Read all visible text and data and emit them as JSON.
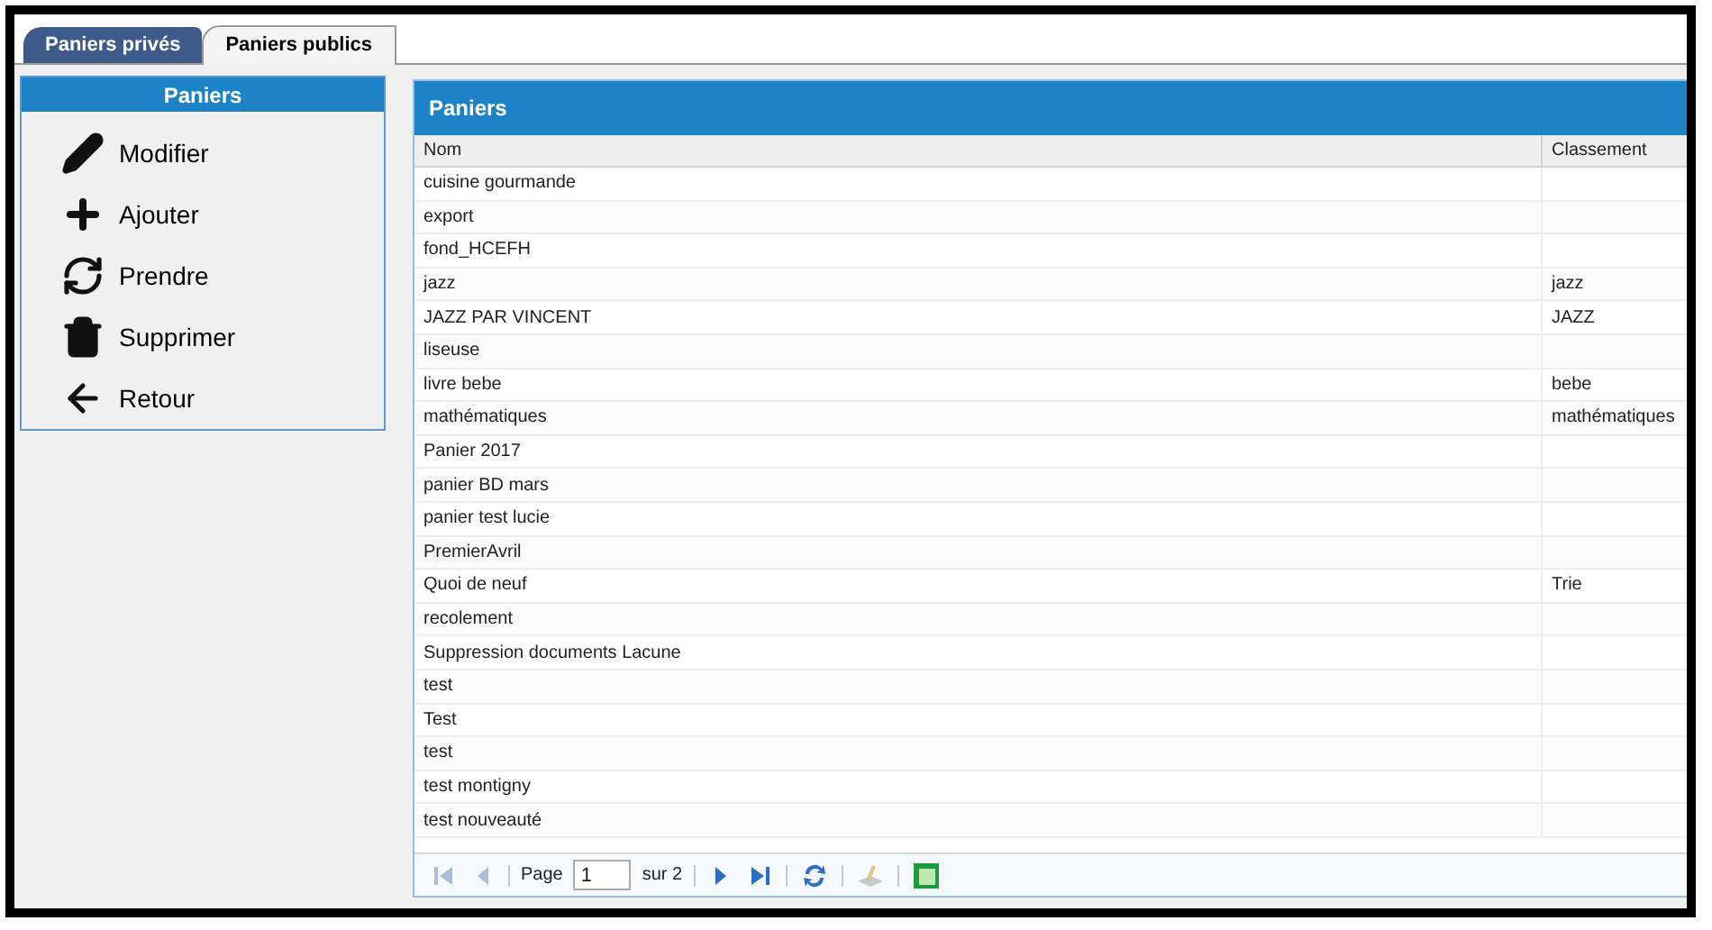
{
  "tabs": [
    {
      "label": "Paniers privés",
      "selected": false
    },
    {
      "label": "Paniers publics",
      "selected": true
    }
  ],
  "actions_panel": {
    "title": "Paniers",
    "items": [
      {
        "kind": "edit",
        "label": "Modifier"
      },
      {
        "kind": "add",
        "label": "Ajouter"
      },
      {
        "kind": "take",
        "label": "Prendre"
      },
      {
        "kind": "delete",
        "label": "Supprimer"
      },
      {
        "kind": "back",
        "label": "Retour"
      }
    ]
  },
  "grid": {
    "title": "Paniers",
    "columns": [
      "Nom",
      "Classement"
    ],
    "rows": [
      {
        "nom": "cuisine gourmande"
      },
      {
        "nom": "export"
      },
      {
        "nom": "fond_HCEFH"
      },
      {
        "nom": "jazz",
        "classement": "jazz"
      },
      {
        "nom": "JAZZ PAR VINCENT",
        "classement": "JAZZ"
      },
      {
        "nom": "liseuse"
      },
      {
        "nom": "livre bebe",
        "classement": "bebe"
      },
      {
        "nom": "mathématiques",
        "classement": "mathématiques"
      },
      {
        "nom": "Panier 2017"
      },
      {
        "nom": "panier BD mars"
      },
      {
        "nom": "panier test lucie"
      },
      {
        "nom": "PremierAvril"
      },
      {
        "nom": "Quoi de neuf",
        "classement": "Trie"
      },
      {
        "nom": "recolement"
      },
      {
        "nom": "Suppression documents Lacune"
      },
      {
        "nom": "test"
      },
      {
        "nom": "Test"
      },
      {
        "nom": "test"
      },
      {
        "nom": "test montigny"
      },
      {
        "nom": "test nouveauté"
      }
    ]
  },
  "pager": {
    "page_label": "Page",
    "page": "1",
    "total_label": "sur 2",
    "buttons": [
      {
        "kind": "first",
        "disabled": true
      },
      {
        "kind": "prev",
        "disabled": true
      },
      {
        "kind": "next",
        "disabled": false
      },
      {
        "kind": "last",
        "disabled": false
      },
      {
        "kind": "refresh",
        "disabled": false
      },
      {
        "kind": "print",
        "disabled": true
      },
      {
        "kind": "excel",
        "disabled": false
      }
    ]
  }
}
